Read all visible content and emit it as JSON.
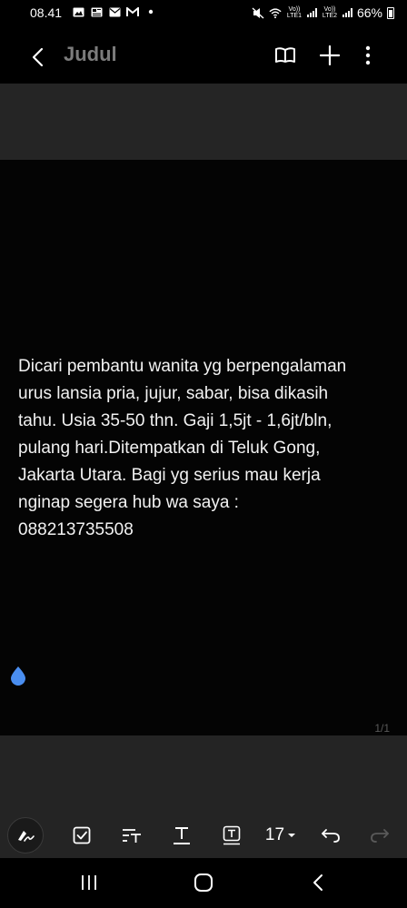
{
  "status_bar": {
    "time": "08.41",
    "left_icons": [
      "image-icon",
      "news-icon",
      "mail-icon",
      "gmail-icon",
      "dot-icon"
    ],
    "right_icons": [
      "mute-icon",
      "wifi-icon",
      "signal-sim1-icon",
      "signal-sim2-icon"
    ],
    "sim1_label": "Vo)) LTE1",
    "sim2_label": "Vo)) LTE2",
    "battery": "66%"
  },
  "header": {
    "title": "Judul",
    "back_icon": "back-arrow-icon",
    "actions": [
      "read-mode-icon",
      "add-icon",
      "more-options-icon"
    ]
  },
  "note": {
    "text": "Dicari pembantu wanita yg berpengalaman\nurus lansia pria, jujur, sabar, bisa dikasih\ntahu. Usia 35-50 thn. Gaji 1,5jt - 1,6jt/bln,\npulang hari.Ditempatkan di Teluk Gong,\nJakarta Utara. Bagi yg serius mau kerja\nnginap segera hub wa saya :\n088213735508",
    "page_indicator": "1/1"
  },
  "toolbar": {
    "font_size": "17",
    "items": [
      "pen-icon",
      "checkbox-icon",
      "text-style-icon",
      "text-underline-icon",
      "text-box-icon",
      "font-size",
      "undo-icon",
      "redo-icon"
    ]
  },
  "colors": {
    "background": "#000000",
    "banner": "#252525",
    "panel": "#242424",
    "title": "#7c7c7c",
    "cursor": "#4a8ef0"
  }
}
